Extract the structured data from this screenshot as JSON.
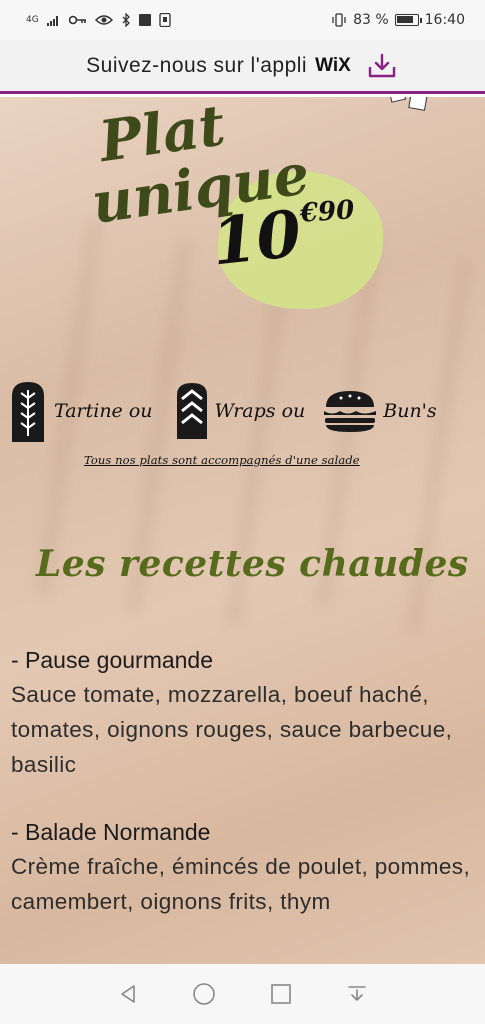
{
  "status_bar": {
    "signal": "4G",
    "battery": "83 %",
    "battery_level": 0.83,
    "time": "16:40"
  },
  "banner": {
    "text": "Suivez-nous sur l'appli",
    "logo": "WiX",
    "icon": "download-icon",
    "accent_color": "#8a1f86"
  },
  "menu": {
    "title_line1": "Plat",
    "title_line2": "unique",
    "price_main": "10",
    "price_cents": "€90",
    "types": [
      {
        "label": "Tartine ou",
        "icon": "wheat-bread-icon"
      },
      {
        "label": "Wraps ou",
        "icon": "wrap-icon"
      },
      {
        "label": "Bun's",
        "icon": "burger-icon"
      }
    ],
    "note": "Tous nos plats sont accompagnés d'une salade",
    "section_title": "Les recettes chaudes",
    "recipes": [
      {
        "name": "- Pause gourmande",
        "desc": "Sauce tomate, mozzarella, boeuf haché, tomates, oignons rouges, sauce barbecue, basilic"
      },
      {
        "name": "- Balade Normande",
        "desc": "Crème fraîche, émincés de poulet, pommes, camembert, oignons frits, thym"
      }
    ]
  },
  "nav": {
    "buttons": [
      "back-icon",
      "home-icon",
      "recents-icon",
      "notifications-icon"
    ]
  }
}
